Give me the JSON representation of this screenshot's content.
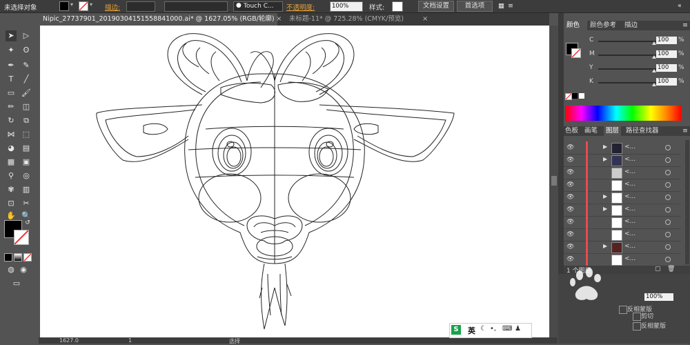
{
  "control_bar": {
    "selection_status": "未选择对象",
    "stroke_label": "描边:",
    "brush_name": "Touch C...",
    "opacity_label": "不透明度:",
    "opacity_value": "100%",
    "style_label": "样式:",
    "doc_setup_button": "文档设置",
    "preferences_button": "首选项"
  },
  "tabs": [
    {
      "label": "Nipic_27737901_20190304151558841000.ai* @ 1627.05% (RGB/轮廓)",
      "active": true
    },
    {
      "label": "未标题-11* @ 725.28% (CMYK/预览)",
      "active": false
    }
  ],
  "color_panel": {
    "tabs": [
      "颜色",
      "颜色参考",
      "描边"
    ],
    "channels": [
      {
        "name": "C",
        "value": "100",
        "unit": "%"
      },
      {
        "name": "M",
        "value": "100",
        "unit": "%"
      },
      {
        "name": "Y",
        "value": "100",
        "unit": "%"
      },
      {
        "name": "K",
        "value": "100",
        "unit": "%"
      }
    ]
  },
  "layers_panel": {
    "tabs": [
      "色板",
      "画笔",
      "图层",
      "路径查找器"
    ],
    "rows": [
      {
        "name": "<...",
        "expandable": true
      },
      {
        "name": "<...",
        "expandable": true
      },
      {
        "name": "<...",
        "expandable": false
      },
      {
        "name": "<...",
        "expandable": false
      },
      {
        "name": "<...",
        "expandable": true
      },
      {
        "name": "<...",
        "expandable": true
      },
      {
        "name": "<...",
        "expandable": false
      },
      {
        "name": "<...",
        "expandable": false
      },
      {
        "name": "<...",
        "expandable": true
      },
      {
        "name": "<...",
        "expandable": false
      }
    ],
    "footer": "1 个图层"
  },
  "transparency_panel": {
    "opacity_value": "100%",
    "clip_label": "剪切",
    "invert_mask_label": "反相蒙版"
  },
  "status_bar": {
    "zoom": "1627.0",
    "page": "1",
    "tool": "选择"
  },
  "ime": {
    "lang": "英"
  },
  "colors": {
    "accent_orange": "#e8a33a",
    "layer_marker": "#e84b4b",
    "panel_bg": "#535353"
  }
}
